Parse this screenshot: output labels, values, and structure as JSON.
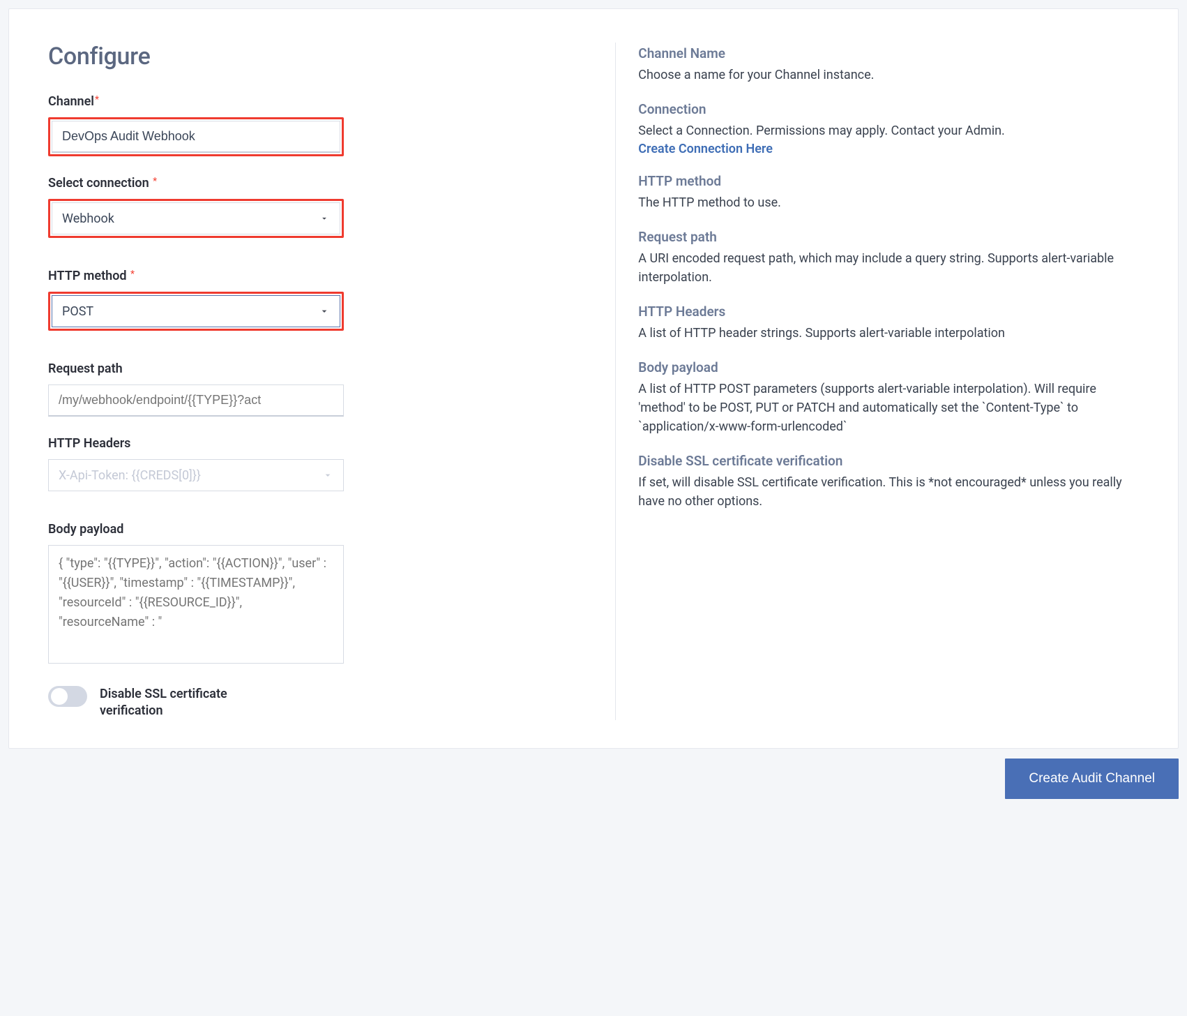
{
  "title": "Configure",
  "fields": {
    "channel": {
      "label": "Channel",
      "value": "DevOps Audit Webhook"
    },
    "connection": {
      "label": "Select connection",
      "value": "Webhook"
    },
    "httpMethod": {
      "label": "HTTP method",
      "value": "POST"
    },
    "requestPath": {
      "label": "Request path",
      "placeholder": "/my/webhook/endpoint/{{TYPE}}?act"
    },
    "httpHeaders": {
      "label": "HTTP Headers",
      "placeholder": "X-Api-Token: {{CREDS[0]}}"
    },
    "bodyPayload": {
      "label": "Body payload",
      "placeholder": "{ \"type\": \"{{TYPE}}\", \"action\": \"{{ACTION}}\", \"user\" : \"{{USER}}\", \"timestamp\" : \"{{TIMESTAMP}}\", \"resourceId\" : \"{{RESOURCE_ID}}\", \"resourceName\" : \""
    },
    "disableSSL": {
      "label": "Disable SSL certificate verification"
    }
  },
  "help": {
    "channelName": {
      "title": "Channel Name",
      "text": "Choose a name for your Channel instance."
    },
    "connection": {
      "title": "Connection",
      "text": "Select a Connection. Permissions may apply. Contact your Admin.",
      "link": "Create Connection Here"
    },
    "httpMethod": {
      "title": "HTTP method",
      "text": "The HTTP method to use."
    },
    "requestPath": {
      "title": "Request path",
      "text": "A URI encoded request path, which may include a query string. Supports alert-variable interpolation."
    },
    "httpHeaders": {
      "title": "HTTP Headers",
      "text": "A list of HTTP header strings. Supports alert-variable interpolation"
    },
    "bodyPayload": {
      "title": "Body payload",
      "text": "A list of HTTP POST parameters (supports alert-variable interpolation). Will require 'method' to be POST, PUT or PATCH and automatically set the `Content-Type` to `application/x-www-form-urlencoded`"
    },
    "disableSSL": {
      "title": "Disable SSL certificate verification",
      "text": "If set, will disable SSL certificate verification. This is *not encouraged* unless you really have no other options."
    }
  },
  "footer": {
    "submit": "Create Audit Channel"
  }
}
